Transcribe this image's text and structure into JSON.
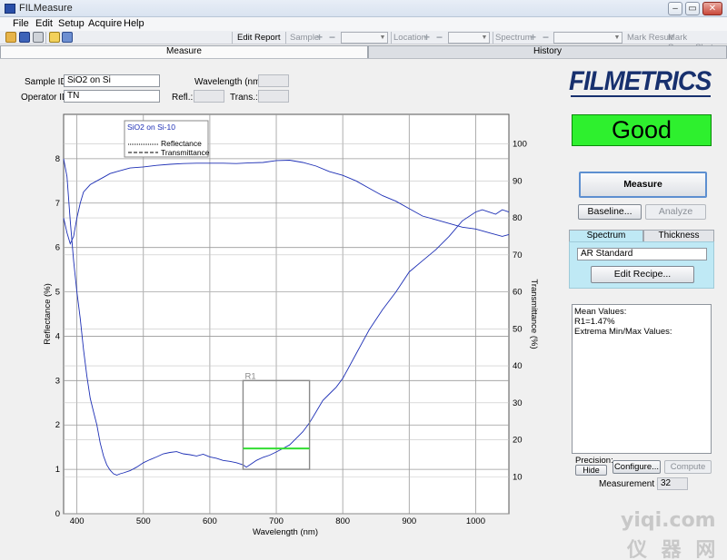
{
  "window": {
    "title": "FILMeasure"
  },
  "menu": [
    "File",
    "Edit",
    "Setup",
    "Acquire",
    "Help"
  ],
  "toolbar": {
    "edit_report": "Edit Report",
    "sample": "Sample",
    "location": "Location",
    "spectrum": "Spectrum",
    "mark_result": "Mark Result",
    "mark_screenshot": "Mark ScreenShot",
    "plus": "+",
    "minus": "−"
  },
  "tabs": {
    "measure": "Measure",
    "history": "History"
  },
  "form": {
    "sample_id_label": "Sample ID:",
    "sample_id_value": "SiO2 on Si",
    "operator_id_label": "Operator ID:",
    "operator_id_value": "TN",
    "wavelength_label": "Wavelength (nm):",
    "wavelength_value": "",
    "refl_label": "Refl.:",
    "refl_value": "",
    "trans_label": "Trans.:",
    "trans_value": ""
  },
  "brand": {
    "logo_text": "FILMETRICS",
    "status": "Good",
    "status_color": "#2ef02e",
    "logo_color": "#17306e"
  },
  "actions": {
    "measure": "Measure",
    "baseline": "Baseline...",
    "analyze": "Analyze"
  },
  "recipe": {
    "tab_spectrum": "Spectrum",
    "tab_thickness": "Thickness",
    "name": "AR Standard",
    "edit_recipe": "Edit Recipe..."
  },
  "results": {
    "lines": [
      "Mean Values:",
      "R1=1.47%",
      "",
      "Extrema Min/Max Values:"
    ]
  },
  "bottom": {
    "precision_label": "Precision:",
    "hide": "Hide",
    "configure": "Configure...",
    "compute": "Compute",
    "measurement_label": "Measurement #",
    "measurement_value": "32"
  },
  "watermark": {
    "main": "yiqi.com",
    "sub": "仪 器 网"
  },
  "chart_data": {
    "type": "line",
    "xlabel": "Wavelength (nm)",
    "ylabel": "Reflectance (%)",
    "y2label": "Transmittance (%)",
    "xlim": [
      380,
      1050
    ],
    "ylim": [
      0,
      9
    ],
    "y2lim": [
      0,
      108
    ],
    "xticks": [
      400,
      500,
      600,
      700,
      800,
      900,
      1000
    ],
    "yticks": [
      0,
      1,
      2,
      3,
      4,
      5,
      6,
      7,
      8
    ],
    "y2ticks": [
      10,
      20,
      30,
      40,
      50,
      60,
      70,
      80,
      90,
      100
    ],
    "grid": true,
    "legend": {
      "title": "SiO2 on Si-10",
      "entries": [
        "Reflectance",
        "Transmittance"
      ],
      "placement": "top-left"
    },
    "series": [
      {
        "name": "Reflectance",
        "axis": "left",
        "color": "#1d2fb5",
        "x": [
          380,
          385,
          390,
          395,
          400,
          405,
          410,
          415,
          420,
          425,
          430,
          435,
          440,
          445,
          450,
          455,
          460,
          465,
          470,
          480,
          490,
          500,
          510,
          520,
          530,
          540,
          550,
          560,
          570,
          580,
          590,
          600,
          610,
          620,
          630,
          640,
          650,
          655,
          660,
          670,
          680,
          690,
          700,
          710,
          720,
          730,
          740,
          750,
          760,
          770,
          780,
          790,
          800,
          820,
          840,
          860,
          880,
          900,
          920,
          940,
          960,
          980,
          1000,
          1010,
          1020,
          1030,
          1040,
          1050
        ],
        "y": [
          8.0,
          7.6,
          6.6,
          5.7,
          5.0,
          4.4,
          3.7,
          3.1,
          2.6,
          2.3,
          2.0,
          1.6,
          1.3,
          1.1,
          0.98,
          0.9,
          0.87,
          0.9,
          0.92,
          0.97,
          1.05,
          1.15,
          1.22,
          1.28,
          1.35,
          1.38,
          1.4,
          1.35,
          1.33,
          1.3,
          1.34,
          1.28,
          1.25,
          1.2,
          1.18,
          1.15,
          1.1,
          1.05,
          1.1,
          1.2,
          1.27,
          1.32,
          1.39,
          1.47,
          1.55,
          1.7,
          1.85,
          2.05,
          2.3,
          2.55,
          2.7,
          2.85,
          3.05,
          3.6,
          4.15,
          4.6,
          5.0,
          5.45,
          5.7,
          5.95,
          6.25,
          6.6,
          6.8,
          6.85,
          6.8,
          6.75,
          6.85,
          6.8
        ]
      },
      {
        "name": "Transmittance",
        "axis": "right",
        "color": "#1d2fb5",
        "x": [
          380,
          385,
          390,
          395,
          400,
          405,
          410,
          420,
          430,
          440,
          450,
          460,
          470,
          480,
          500,
          520,
          540,
          560,
          580,
          600,
          620,
          640,
          660,
          680,
          700,
          720,
          740,
          760,
          780,
          800,
          820,
          840,
          860,
          880,
          900,
          920,
          940,
          960,
          980,
          1000,
          1020,
          1040,
          1050
        ],
        "y": [
          80,
          76,
          73,
          75,
          80,
          84,
          87,
          89,
          90,
          91,
          92,
          92.5,
          93,
          93.5,
          93.8,
          94.2,
          94.5,
          94.7,
          94.8,
          94.8,
          94.8,
          94.7,
          94.9,
          95.0,
          95.5,
          95.6,
          95.0,
          94.0,
          92.5,
          91.5,
          90.0,
          88.0,
          86.0,
          84.5,
          82.5,
          80.5,
          79.5,
          78.5,
          77.5,
          77.0,
          76.0,
          75.0,
          75.5
        ]
      }
    ],
    "region": {
      "label": "R1",
      "x": [
        650,
        750
      ],
      "y": [
        1.0,
        3.0
      ],
      "value": 1.47,
      "color": "#33dd33"
    }
  }
}
